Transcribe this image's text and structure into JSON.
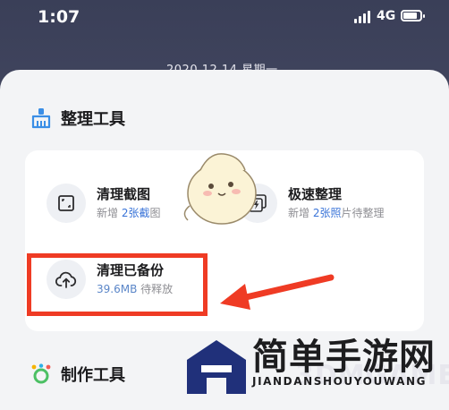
{
  "status_bar": {
    "time": "1:07",
    "network": "4G"
  },
  "lock_screen": {
    "date": "2020.12.14  星期一"
  },
  "section_organize": {
    "title": "整理工具",
    "icon": "broom-icon"
  },
  "tools": [
    {
      "name": "清理截图",
      "sub_prefix": "新增 ",
      "sub_highlight": "2张截",
      "sub_suffix": "图",
      "icon": "screenshot-crop-icon"
    },
    {
      "name": "极速整理",
      "sub_prefix": "新增 ",
      "sub_highlight": "2张照",
      "sub_suffix": "片待整理",
      "icon": "photos-lightning-icon"
    },
    {
      "name": "清理已备份",
      "sub_highlight": "39.6MB",
      "sub_suffix": " 待释放",
      "icon": "cloud-upload-icon"
    }
  ],
  "section_create": {
    "title": "制作工具",
    "icon": "sparkle-icon"
  },
  "annotation": {
    "box_color": "#ef3b24",
    "arrow_color": "#ef3b24"
  },
  "watermark": {
    "title": "简单手游网",
    "pinyin": "JIANDANSHOUYOUWANG",
    "overlay": "3DMGAME"
  },
  "colors": {
    "accent_blue": "#3a74d8",
    "sheet_bg": "#f3f4f6",
    "card_bg": "#ffffff"
  }
}
